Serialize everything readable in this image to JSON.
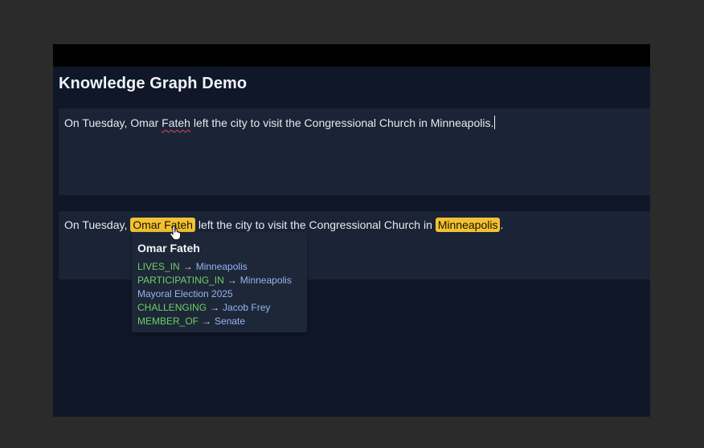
{
  "app": {
    "title": "Knowledge Graph Demo"
  },
  "editor": {
    "before": "On Tuesday, Omar ",
    "misspelled": "Fateh",
    "after": " left the city to visit the Congressional Church in Minneapolis."
  },
  "output": {
    "part1": "On Tuesday, ",
    "entity1": "Omar Fateh",
    "part2": " left the city to visit the Congressional Church in ",
    "entity2": "Minneapolis",
    "part3": "."
  },
  "tooltip": {
    "title": "Omar Fateh",
    "relations": [
      {
        "type": "LIVES_IN",
        "arrow": "→",
        "target": "Minneapolis"
      },
      {
        "type": "PARTICIPATING_IN",
        "arrow": "→",
        "target": "Minneapolis"
      },
      {
        "type": "",
        "arrow": "",
        "target": "Mayoral Election 2025"
      },
      {
        "type": "CHALLENGING",
        "arrow": "→",
        "target": "Jacob Frey"
      },
      {
        "type": "MEMBER_OF",
        "arrow": "→",
        "target": "Senate"
      }
    ]
  },
  "colors": {
    "entity_highlight": "#f2c232",
    "relation_type": "#6fcf6a",
    "relation_target": "#93b4f0",
    "panel_bg": "#1b2436",
    "page_bg": "#0f1729"
  },
  "icons": {
    "cursor": "hand-pointer-icon"
  }
}
